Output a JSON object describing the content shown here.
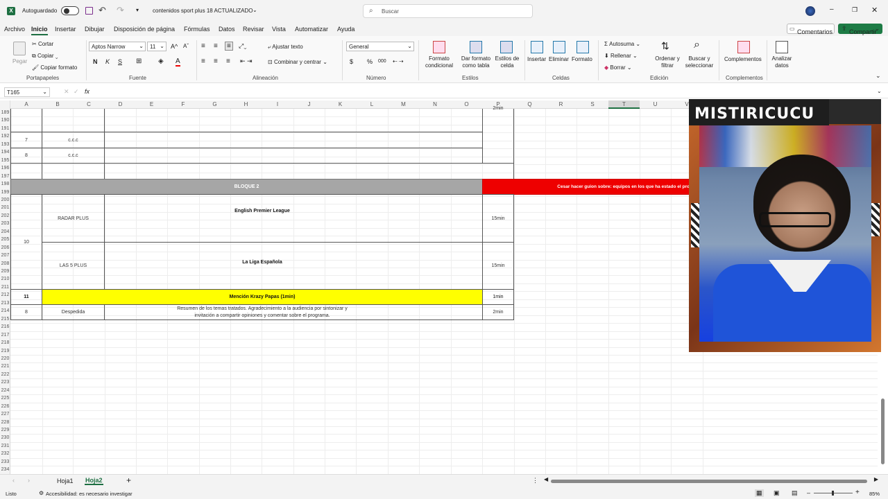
{
  "titlebar": {
    "autosave": "Autoguardado",
    "doc_title": "contenidos sport plus 18 ACTUALIZADO",
    "search_placeholder": "Buscar"
  },
  "menu": [
    "Archivo",
    "Inicio",
    "Insertar",
    "Dibujar",
    "Disposición de página",
    "Fórmulas",
    "Datos",
    "Revisar",
    "Vista",
    "Automatizar",
    "Ayuda"
  ],
  "actions": {
    "comments": "Comentarios",
    "share": "Compartir"
  },
  "ribbon": {
    "clipboard": {
      "paste": "Pegar",
      "cut": "Cortar",
      "copy": "Copiar",
      "format_painter": "Copiar formato",
      "group": "Portapapeles"
    },
    "font": {
      "name": "Aptos Narrow",
      "size": "11",
      "bold": "N",
      "italic": "K",
      "underline": "S",
      "fill_label": "A",
      "group": "Fuente"
    },
    "alignment": {
      "wrap": "Ajustar texto",
      "merge": "Combinar y centrar",
      "group": "Alineación"
    },
    "number": {
      "format": "General",
      "currency": "$",
      "percent": "%",
      "thousands": "000",
      "group": "Número"
    },
    "styles": {
      "cond_format": "Formato condicional",
      "format_table": "Dar formato como tabla",
      "cell_styles": "Estilos de celda",
      "group": "Estilos"
    },
    "cells": {
      "insert": "Insertar",
      "delete": "Eliminar",
      "format": "Formato",
      "group": "Celdas"
    },
    "editing": {
      "autosum": "Autosuma",
      "fill": "Rellenar",
      "clear": "Borrar",
      "sort": "Ordenar y filtrar",
      "find": "Buscar y seleccionar",
      "group": "Edición"
    },
    "addins": {
      "addins": "Complementos",
      "group": "Complementos"
    },
    "analyze": {
      "label": "Analizar datos"
    }
  },
  "formula_bar": {
    "name_box": "T165",
    "fx": "fx",
    "value": ""
  },
  "columns": [
    "A",
    "B",
    "C",
    "D",
    "E",
    "F",
    "G",
    "H",
    "I",
    "J",
    "K",
    "L",
    "M",
    "N",
    "O",
    "P",
    "Q",
    "R",
    "S",
    "T",
    "U",
    "V"
  ],
  "rows": [
    "189",
    "190",
    "191",
    "192",
    "193",
    "194",
    "195",
    "196",
    "197",
    "198",
    "199",
    "200",
    "201",
    "202",
    "203",
    "204",
    "205",
    "206",
    "207",
    "208",
    "209",
    "210",
    "211",
    "212",
    "213",
    "214",
    "215",
    "216",
    "217",
    "218",
    "219",
    "220",
    "221",
    "222",
    "223",
    "224",
    "225",
    "226",
    "227",
    "228",
    "229",
    "230",
    "231",
    "232",
    "233",
    "234"
  ],
  "sheet": {
    "top_time": "2min",
    "r7_num": "7",
    "r7_label": "c.c.c",
    "r8_num": "8",
    "r8_label": "c.c.c",
    "bloque": "BLOQUE 2",
    "red_note": "Cesar hacer guion sobre: equipos en los que ha estado el pro",
    "g10_num": "10",
    "radar": "RADAR PLUS",
    "epl": "English Premier League",
    "epl_time": "15min",
    "las5": "LAS 5 PLUS",
    "laliga": "La Liga Española",
    "laliga_time": "15min",
    "r11_num": "11",
    "mencion": "Mención Krazy Papas (1min)",
    "mencion_time": "1min",
    "r8b_num": "8",
    "despedida": "Despedida",
    "resumen1": "Resumen de los temas tratados. Agradecimiento a la audiencia por sintonizar y",
    "resumen2": "invitación a compartir opiniones y comentar sobre el programa.",
    "desp_time": "2min"
  },
  "overlay": {
    "name": "MISTIRICUCU"
  },
  "tabs": [
    "Hoja1",
    "Hoja2"
  ],
  "status": {
    "ready": "Listo",
    "accessibility": "Accesibilidad: es necesario investigar",
    "zoom": "85%"
  }
}
